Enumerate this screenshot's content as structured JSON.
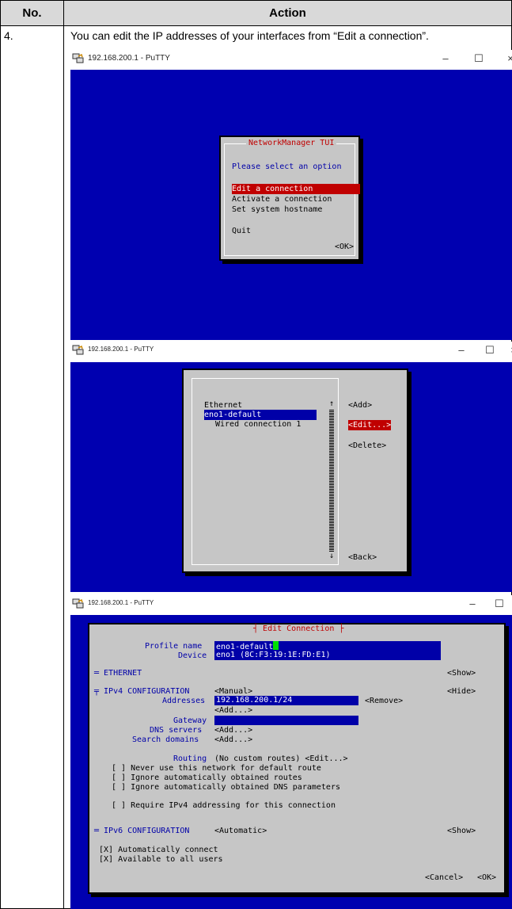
{
  "table": {
    "header_no": "No.",
    "header_action": "Action",
    "row_no": "4.",
    "row_text": "You can edit the IP addresses of your interfaces from “Edit a connection”."
  },
  "window1": {
    "title": "192.168.200.1 - PuTTY",
    "dialog_title": "NetworkManager TUI",
    "prompt": "Please select an option",
    "options": [
      "Edit a connection",
      "Activate a connection",
      "Set system hostname"
    ],
    "quit": "Quit",
    "ok": "<OK>"
  },
  "window2": {
    "title": "192.168.200.1 - PuTTY",
    "group": "Ethernet",
    "items": [
      "eno1-default",
      "Wired connection 1"
    ],
    "add": "<Add>",
    "edit": "<Edit...>",
    "delete": "<Delete>",
    "back": "<Back>"
  },
  "window3": {
    "title": "192.168.200.1 - PuTTY",
    "dialog_title": "Edit Connection",
    "profile_name_label": "Profile name",
    "profile_name_value": "eno1-default",
    "device_label": "Device",
    "device_value": "eno1 (8C:F3:19:1E:FD:E1)",
    "ethernet_label": "═ ETHERNET",
    "show1": "<Show>",
    "ipv4_label": "╤ IPv4 CONFIGURATION",
    "ipv4_mode": "<Manual>",
    "hide": "<Hide>",
    "addresses_label": "Addresses",
    "addresses_value": "192.168.200.1/24",
    "remove": "<Remove>",
    "add_addr": "<Add...>",
    "gateway_label": "Gateway",
    "dns_label": "DNS servers",
    "dns_add": "<Add...>",
    "search_label": "Search domains",
    "search_add": "<Add...>",
    "routing_label": "Routing",
    "routing_value": "(No custom routes) <Edit...>",
    "check1": "[ ] Never use this network for default route",
    "check2": "[ ] Ignore automatically obtained routes",
    "check3": "[ ] Ignore automatically obtained DNS parameters",
    "check4": "[ ] Require IPv4 addressing for this connection",
    "ipv6_label": "═ IPv6 CONFIGURATION",
    "ipv6_mode": "<Automatic>",
    "show2": "<Show>",
    "auto_connect": "[X] Automatically connect",
    "all_users": "[X] Available to all users",
    "cancel": "<Cancel>",
    "ok": "<OK>"
  }
}
